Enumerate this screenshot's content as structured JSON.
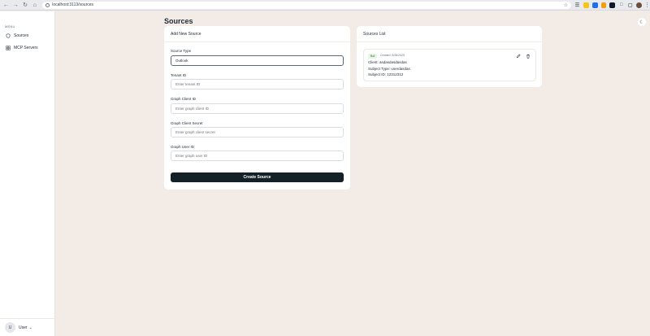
{
  "browser": {
    "url": "localhost:3113/sources",
    "back_icon": "arrow-left-icon",
    "forward_icon": "arrow-right-icon",
    "reload_icon": "reload-icon",
    "home_icon": "home-icon",
    "bookmark_icon": "star-icon"
  },
  "sidebar": {
    "menu_label": "MENU",
    "items": [
      {
        "label": "Sources",
        "icon": "shield-icon"
      },
      {
        "label": "MCP Servers",
        "icon": "grid-icon"
      }
    ],
    "user": {
      "initial": "U",
      "name": "User"
    }
  },
  "main": {
    "title": "Sources"
  },
  "add_source": {
    "title": "Add New Source",
    "fields": [
      {
        "label": "Source Type",
        "value": "Outlook",
        "placeholder": ""
      },
      {
        "label": "Tenant ID",
        "value": "",
        "placeholder": "Enter tenant ID"
      },
      {
        "label": "Graph Client ID",
        "value": "",
        "placeholder": "Enter graph client ID"
      },
      {
        "label": "Graph Client Secret",
        "value": "",
        "placeholder": "Enter graph client secret"
      },
      {
        "label": "Graph User ID",
        "value": "",
        "placeholder": "Enter graph user ID"
      }
    ],
    "submit_label": "Create Source"
  },
  "sources_list": {
    "title": "Sources List",
    "items": [
      {
        "badge": "Bot",
        "created": "Created: 8/28/2025",
        "client": "Client: asdasdasdasdas",
        "subject_type": "Subject Type: userdasdas",
        "subject_id": "Subject ID: 12312312"
      }
    ]
  },
  "colors": {
    "background": "#f3ece6",
    "primary_button": "#142127",
    "badge_bg": "#e7f3e3",
    "badge_text": "#3f6f2f"
  }
}
